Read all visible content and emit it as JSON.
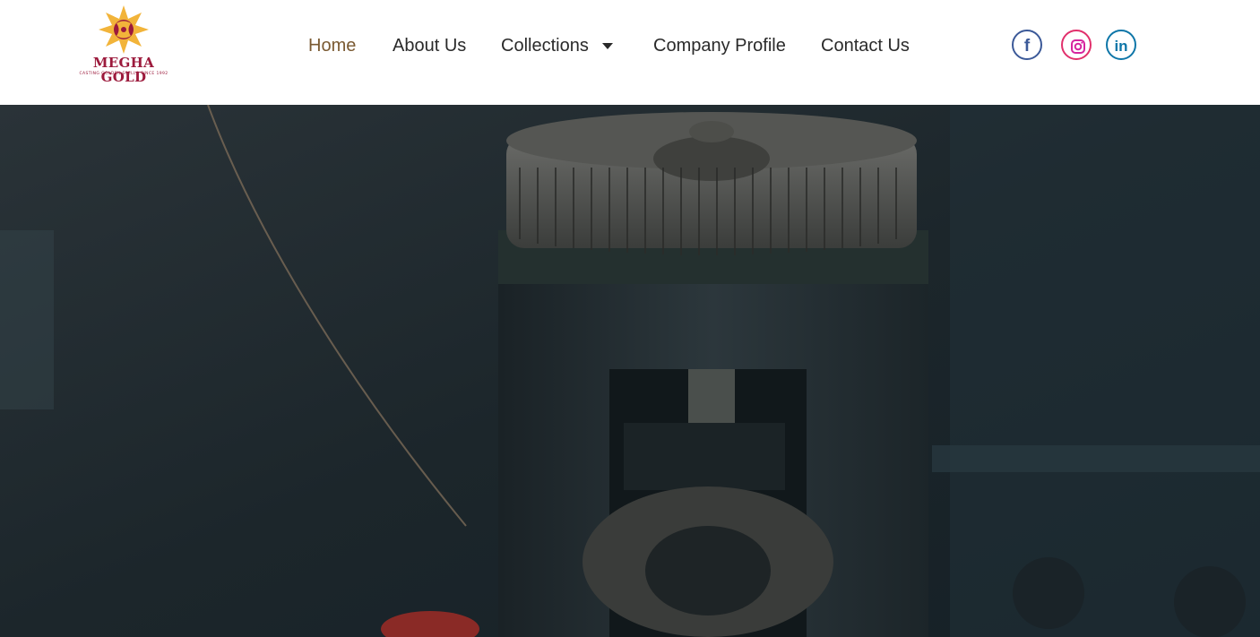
{
  "brand": {
    "name": "MEGHA GOLD",
    "tagline": "CASTING GOLDEN SPELLS SINCE 1992",
    "colors": {
      "primary": "#9c1a3c",
      "gold": "#f2b43a"
    }
  },
  "nav": {
    "items": [
      {
        "label": "Home",
        "active": true
      },
      {
        "label": "About Us"
      },
      {
        "label": "Collections",
        "has_dropdown": true
      },
      {
        "label": "Company Profile"
      },
      {
        "label": "Contact Us"
      }
    ],
    "active_color": "#7a5a32",
    "text_color": "#2a2a2a"
  },
  "social": [
    {
      "name": "facebook-icon",
      "glyph": "f",
      "color": "#3b5998"
    },
    {
      "name": "instagram-icon",
      "glyph": "◎",
      "color": "#d6249f"
    },
    {
      "name": "linkedin-icon",
      "glyph": "in",
      "color": "#0e76a8"
    }
  ]
}
